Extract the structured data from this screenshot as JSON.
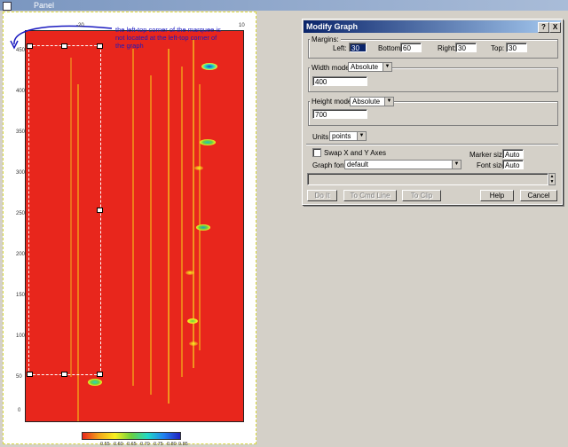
{
  "window": {
    "title": "Panel"
  },
  "graph": {
    "annotation": "the left-top corner of the marquee is not located at the left-top corner of the graph",
    "x_ticks": [
      "-20",
      "10"
    ],
    "y_ticks": [
      "450",
      "400",
      "350",
      "300",
      "250",
      "200",
      "150",
      "100",
      "50",
      "0"
    ],
    "colorbar_ticks": [
      "0.55",
      "0.60",
      "0.65",
      "0.70",
      "0.75",
      "0.80",
      "0.85"
    ]
  },
  "dialog": {
    "title": "Modify Graph",
    "help_btn": "?",
    "close_btn": "X",
    "margins": {
      "label": "Margins:",
      "left_label": "Left:",
      "left_value": "30",
      "bottom_label": "Bottom:",
      "bottom_value": "60",
      "right_label": "Right:",
      "right_value": "30",
      "top_label": "Top:",
      "top_value": "30"
    },
    "width": {
      "mode_label": "Width mode:",
      "mode_value": "Absolute",
      "value": "400"
    },
    "height": {
      "mode_label": "Height mode:",
      "mode_value": "Absolute",
      "value": "700"
    },
    "units": {
      "label": "Units:",
      "value": "points"
    },
    "swap_label": "Swap X and Y Axes",
    "marker": {
      "label": "Marker size:",
      "value": "Auto"
    },
    "graph_font": {
      "label": "Graph font:",
      "value": "default"
    },
    "font_size": {
      "label": "Font size:",
      "value": "Auto"
    },
    "buttons": {
      "doit": "Do It",
      "to_cmd": "To Cmd Line",
      "to_clip": "To Clip",
      "help": "Help",
      "cancel": "Cancel"
    }
  }
}
